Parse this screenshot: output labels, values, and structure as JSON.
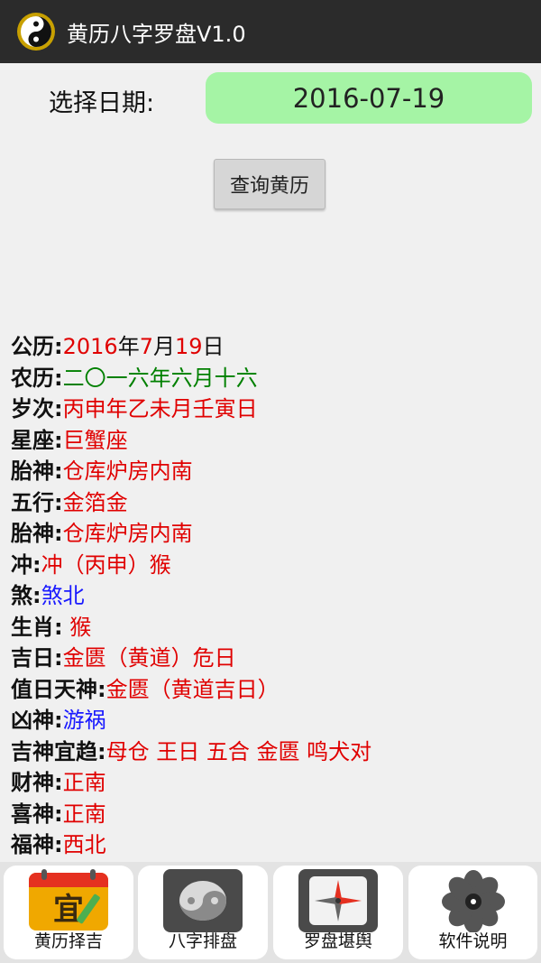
{
  "app": {
    "title": "黄历八字罗盘V1.0"
  },
  "date": {
    "label": "选择日期:",
    "value": "2016-07-19"
  },
  "query_button": "查询黄历",
  "info": {
    "gongli": {
      "key": "公历:",
      "year": "2016",
      "y_unit": "年",
      "month": "7",
      "m_unit": "月",
      "day": "19",
      "d_unit": "日"
    },
    "nongli": {
      "key": "农历:",
      "value": "二〇一六年六月十六"
    },
    "suici": {
      "key": "岁次:",
      "value": "丙申年乙未月壬寅日"
    },
    "xingzuo": {
      "key": "星座:",
      "value": "巨蟹座"
    },
    "taishen1": {
      "key": "胎神:",
      "value": "仓库炉房内南"
    },
    "wuxing": {
      "key": "五行:",
      "value": "金箔金"
    },
    "taishen2": {
      "key": "胎神:",
      "value": "仓库炉房内南"
    },
    "chong": {
      "key": "冲:",
      "value": "冲（丙申）猴"
    },
    "sha": {
      "key": "煞:",
      "value": "煞北"
    },
    "shengxiao": {
      "key": "生肖:",
      "value": " 猴"
    },
    "jiri": {
      "key": "吉日:",
      "value": "金匮（黄道）危日"
    },
    "zhiri": {
      "key": "值日天神:",
      "value": "金匮（黄道吉日）"
    },
    "xiongshen": {
      "key": "凶神:",
      "value": "游祸"
    },
    "jishen": {
      "key": "吉神宜趋:",
      "value": "母仓 王日 五合 金匮 鸣犬对"
    },
    "caishen": {
      "key": "财神:",
      "value": "正南"
    },
    "xishen": {
      "key": "喜神:",
      "value": "正南"
    },
    "fushen": {
      "key": "福神:",
      "value": "西北"
    }
  },
  "tabs": {
    "huangli": {
      "label": "黄历择吉",
      "icon_text": "宜"
    },
    "bazi": {
      "label": "八字排盘"
    },
    "luopan": {
      "label": "罗盘堪舆"
    },
    "about": {
      "label": "软件说明"
    }
  },
  "colors": {
    "titlebar": "#2b2b2b",
    "date_bg": "#a5f4a5",
    "red": "#e00000",
    "green": "#008000",
    "blue": "#1a1aff"
  }
}
